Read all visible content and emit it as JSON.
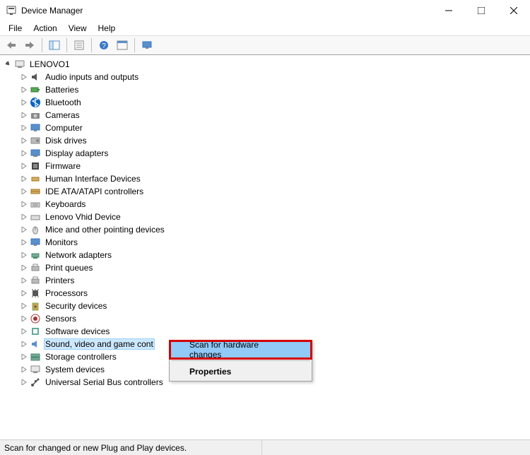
{
  "window": {
    "title": "Device Manager"
  },
  "menu": {
    "file": "File",
    "action": "Action",
    "view": "View",
    "help": "Help"
  },
  "tree": {
    "root": "LENOVO1",
    "items": [
      {
        "label": "Audio inputs and outputs"
      },
      {
        "label": "Batteries"
      },
      {
        "label": "Bluetooth"
      },
      {
        "label": "Cameras"
      },
      {
        "label": "Computer"
      },
      {
        "label": "Disk drives"
      },
      {
        "label": "Display adapters"
      },
      {
        "label": "Firmware"
      },
      {
        "label": "Human Interface Devices"
      },
      {
        "label": "IDE ATA/ATAPI controllers"
      },
      {
        "label": "Keyboards"
      },
      {
        "label": "Lenovo Vhid Device"
      },
      {
        "label": "Mice and other pointing devices"
      },
      {
        "label": "Monitors"
      },
      {
        "label": "Network adapters"
      },
      {
        "label": "Print queues"
      },
      {
        "label": "Printers"
      },
      {
        "label": "Processors"
      },
      {
        "label": "Security devices"
      },
      {
        "label": "Sensors"
      },
      {
        "label": "Software devices"
      },
      {
        "label": "Sound, video and game cont",
        "selected": true
      },
      {
        "label": "Storage controllers"
      },
      {
        "label": "System devices"
      },
      {
        "label": "Universal Serial Bus controllers"
      }
    ]
  },
  "context_menu": {
    "scan": "Scan for hardware changes",
    "properties": "Properties"
  },
  "statusbar": {
    "text": "Scan for changed or new Plug and Play devices."
  }
}
